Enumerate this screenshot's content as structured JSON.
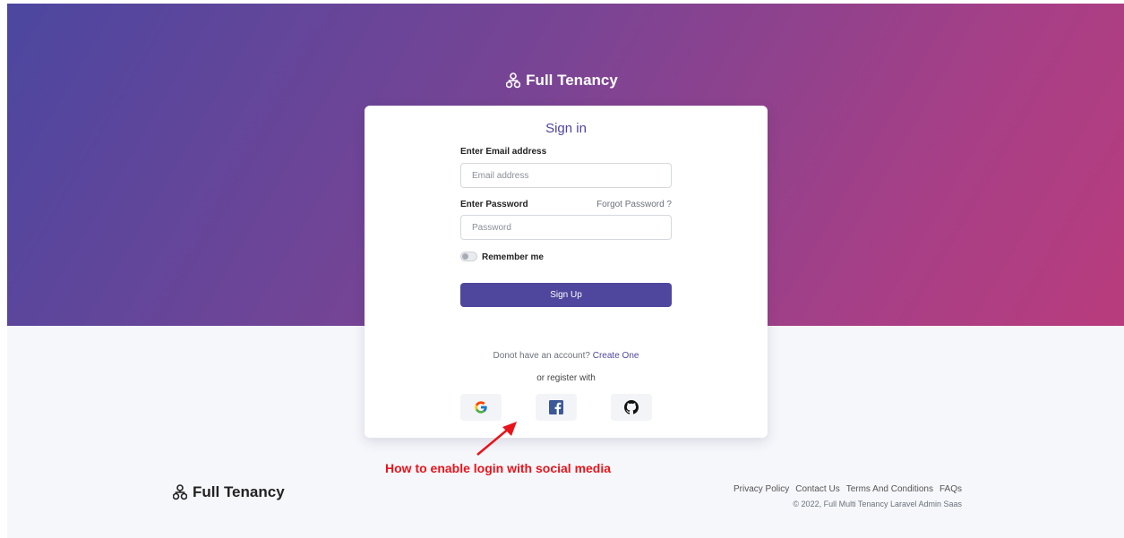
{
  "brand": {
    "name": "Full Tenancy",
    "logo_icon": "network-nodes-icon"
  },
  "colors": {
    "primary": "#4f479e",
    "gradient_start": "#4c47a0",
    "gradient_end": "#b83c7d",
    "annotation": "#e8141b"
  },
  "signin": {
    "title": "Sign in",
    "email_label": "Enter Email address",
    "email_placeholder": "Email address",
    "email_value": "",
    "password_label": "Enter Password",
    "password_placeholder": "Password",
    "password_value": "",
    "forgot_label": "Forgot Password ?",
    "remember_label": "Remember me",
    "remember_checked": false,
    "submit_label": "Sign Up",
    "no_account_text": "Donot have an account?",
    "create_link": "Create One",
    "or_register": "or register with",
    "social": [
      {
        "name": "google",
        "icon": "google-icon"
      },
      {
        "name": "facebook",
        "icon": "facebook-icon"
      },
      {
        "name": "github",
        "icon": "github-icon"
      }
    ]
  },
  "annotation": {
    "text": "How to enable login with social media"
  },
  "footer": {
    "links": [
      "Privacy Policy",
      "Contact Us",
      "Terms And Conditions",
      "FAQs"
    ],
    "copyright": "© 2022, Full Multi Tenancy Laravel Admin Saas"
  }
}
